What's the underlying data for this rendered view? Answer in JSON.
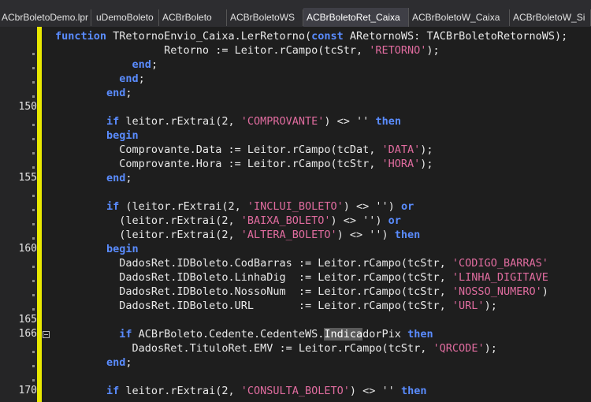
{
  "tabs": [
    {
      "label": "ACbrBoletoDemo.lpr",
      "active": false
    },
    {
      "label": "uDemoBoleto",
      "active": false
    },
    {
      "label": "ACBrBoleto",
      "active": false
    },
    {
      "label": "ACBrBoletoWS",
      "active": false
    },
    {
      "label": "ACBrBoletoRet_Caixa",
      "active": true
    },
    {
      "label": "ACBrBoletoW_Caixa",
      "active": false
    },
    {
      "label": "ACBrBoletoW_Si",
      "active": false
    }
  ],
  "line_numbers": [
    "150",
    "155",
    "160",
    "165",
    "166",
    "170"
  ],
  "code": [
    [
      [
        "function ",
        "kw"
      ],
      [
        "TRetornoEnvio_Caixa.LerRetorno(",
        "id"
      ],
      [
        "const ",
        "kw"
      ],
      [
        "ARetornoWS: TACBrBoletoRetornoWS);",
        "id"
      ]
    ],
    [
      [
        "                 Retorno := Leitor.rCampo(tcStr, ",
        "id"
      ],
      [
        "'RETORNO'",
        "str"
      ],
      [
        ");",
        "id"
      ]
    ],
    [
      [
        "            ",
        "id"
      ],
      [
        "end",
        "kw"
      ],
      [
        ";",
        "id"
      ]
    ],
    [
      [
        "          ",
        "id"
      ],
      [
        "end",
        "kw"
      ],
      [
        ";",
        "id"
      ]
    ],
    [
      [
        "        ",
        "id"
      ],
      [
        "end",
        "kw"
      ],
      [
        ";",
        "id"
      ]
    ],
    [
      [
        "",
        "id"
      ]
    ],
    [
      [
        "        ",
        "id"
      ],
      [
        "if ",
        "kw"
      ],
      [
        "leitor.rExtrai(2, ",
        "id"
      ],
      [
        "'COMPROVANTE'",
        "str"
      ],
      [
        ") <> '' ",
        "id"
      ],
      [
        "then",
        "kw"
      ]
    ],
    [
      [
        "        ",
        "id"
      ],
      [
        "begin",
        "kw"
      ]
    ],
    [
      [
        "          Comprovante.Data := Leitor.rCampo(tcDat, ",
        "id"
      ],
      [
        "'DATA'",
        "str"
      ],
      [
        ");",
        "id"
      ]
    ],
    [
      [
        "          Comprovante.Hora := Leitor.rCampo(tcStr, ",
        "id"
      ],
      [
        "'HORA'",
        "str"
      ],
      [
        ");",
        "id"
      ]
    ],
    [
      [
        "        ",
        "id"
      ],
      [
        "end",
        "kw"
      ],
      [
        ";",
        "id"
      ]
    ],
    [
      [
        "",
        "id"
      ]
    ],
    [
      [
        "        ",
        "id"
      ],
      [
        "if ",
        "kw"
      ],
      [
        "(leitor.rExtrai(2, ",
        "id"
      ],
      [
        "'INCLUI_BOLETO'",
        "str"
      ],
      [
        ") <> '') ",
        "id"
      ],
      [
        "or",
        "kw"
      ]
    ],
    [
      [
        "          (leitor.rExtrai(2, ",
        "id"
      ],
      [
        "'BAIXA_BOLETO'",
        "str"
      ],
      [
        ") <> '') ",
        "id"
      ],
      [
        "or",
        "kw"
      ]
    ],
    [
      [
        "          (leitor.rExtrai(2, ",
        "id"
      ],
      [
        "'ALTERA_BOLETO'",
        "str"
      ],
      [
        ") <> '') ",
        "id"
      ],
      [
        "then",
        "kw"
      ]
    ],
    [
      [
        "        ",
        "id"
      ],
      [
        "begin",
        "kw"
      ]
    ],
    [
      [
        "          DadosRet.IDBoleto.CodBarras := Leitor.rCampo(tcStr, ",
        "id"
      ],
      [
        "'CODIGO_BARRAS'",
        "str"
      ]
    ],
    [
      [
        "          DadosRet.IDBoleto.LinhaDig  := Leitor.rCampo(tcStr, ",
        "id"
      ],
      [
        "'LINHA_DIGITAVE",
        "str"
      ]
    ],
    [
      [
        "          DadosRet.IDBoleto.NossoNum  := Leitor.rCampo(tcStr, ",
        "id"
      ],
      [
        "'NOSSO_NUMERO'",
        "str"
      ],
      [
        ")",
        "id"
      ]
    ],
    [
      [
        "          DadosRet.IDBoleto.URL       := Leitor.rCampo(tcStr, ",
        "id"
      ],
      [
        "'URL'",
        "str"
      ],
      [
        ");",
        "id"
      ]
    ],
    [
      [
        "",
        "id"
      ]
    ],
    [
      [
        "          ",
        "id"
      ],
      [
        "if ",
        "kw"
      ],
      [
        "ACBrBoleto.Cedente.CedenteWS.",
        "id"
      ],
      [
        "Indica",
        "hl"
      ],
      [
        "dorPix ",
        "id"
      ],
      [
        "then",
        "kw"
      ]
    ],
    [
      [
        "            DadosRet.TituloRet.EMV := Leitor.rCampo(tcStr, ",
        "id"
      ],
      [
        "'QRCODE'",
        "str"
      ],
      [
        ");",
        "id"
      ]
    ],
    [
      [
        "        ",
        "id"
      ],
      [
        "end",
        "kw"
      ],
      [
        ";",
        "id"
      ]
    ],
    [
      [
        "",
        "id"
      ]
    ],
    [
      [
        "        ",
        "id"
      ],
      [
        "if ",
        "kw"
      ],
      [
        "leitor.rExtrai(2, ",
        "id"
      ],
      [
        "'CONSULTA_BOLETO'",
        "str"
      ],
      [
        ") <> '' ",
        "id"
      ],
      [
        "then",
        "kw"
      ]
    ]
  ]
}
